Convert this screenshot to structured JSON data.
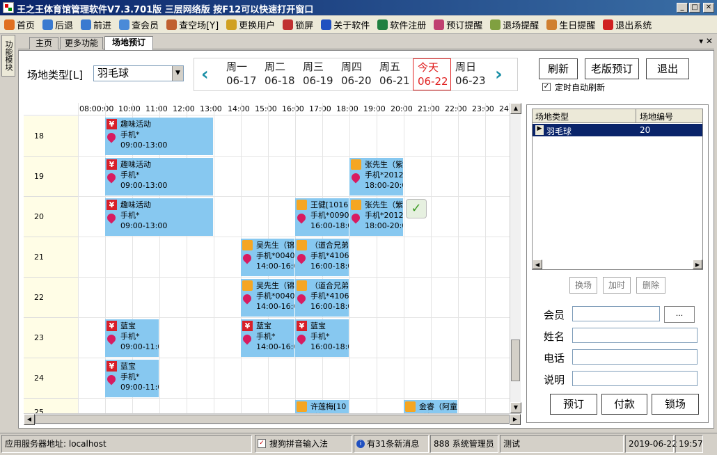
{
  "window": {
    "title": "王之王体育馆管理软件V7.3.701版 三层网络版 按F12可以快速打开窗口",
    "min": "_",
    "max": "□",
    "close": "✕"
  },
  "toolbar": {
    "items": [
      {
        "label": "首页",
        "icon": "home-icon",
        "color": "#e07020"
      },
      {
        "label": "后退",
        "icon": "back-arrow-icon",
        "color": "#3a7ad0"
      },
      {
        "label": "前进",
        "icon": "forward-arrow-icon",
        "color": "#3a7ad0"
      },
      {
        "label": "查会员",
        "icon": "member-icon",
        "color": "#4a8ad8"
      },
      {
        "label": "查空场[Y]",
        "icon": "search-court-icon",
        "color": "#c06030"
      },
      {
        "label": "更换用户",
        "icon": "switch-user-icon",
        "color": "#d0a020"
      },
      {
        "label": "锁屏",
        "icon": "lock-icon",
        "color": "#c03030"
      },
      {
        "label": "关于软件",
        "icon": "info-icon",
        "color": "#2050c0"
      },
      {
        "label": "软件注册",
        "icon": "register-icon",
        "color": "#208040"
      },
      {
        "label": "预订提醒",
        "icon": "booking-reminder-icon",
        "color": "#c04070"
      },
      {
        "label": "退场提醒",
        "icon": "exit-reminder-icon",
        "color": "#80a040"
      },
      {
        "label": "生日提醒",
        "icon": "birthday-icon",
        "color": "#d08030"
      },
      {
        "label": "退出系统",
        "icon": "power-icon",
        "color": "#d02020"
      }
    ]
  },
  "side_tab": "功能模块",
  "tabs": [
    "主页",
    "更多功能",
    "场地预订"
  ],
  "tab_close": "▾ ✕",
  "venue_type_label": "场地类型[L]",
  "venue_type_value": "羽毛球",
  "days": [
    {
      "name": "周一",
      "date": "06-17"
    },
    {
      "name": "周二",
      "date": "06-18"
    },
    {
      "name": "周三",
      "date": "06-19"
    },
    {
      "name": "周四",
      "date": "06-20"
    },
    {
      "name": "周五",
      "date": "06-21"
    },
    {
      "name": "今天",
      "date": "06-22"
    },
    {
      "name": "周日",
      "date": "06-23"
    }
  ],
  "nav_prev": "‹",
  "nav_next": "›",
  "buttons": {
    "refresh": "刷新",
    "old_booking": "老版预订",
    "exit": "退出"
  },
  "auto_refresh_label": "定时自动刷新",
  "auto_refresh_checked": "✓",
  "hours": [
    "08:00:00",
    "10:00",
    "11:00",
    "12:00",
    "13:00",
    "14:00",
    "15:00",
    "16:00",
    "17:00",
    "18:00",
    "19:00",
    "20:00",
    "21:00",
    "22:00",
    "23:00",
    "24"
  ],
  "rows": [
    "18",
    "19",
    "20",
    "21",
    "22",
    "23",
    "24",
    "25"
  ],
  "bookings": [
    {
      "id": "b1",
      "name": "趣味活动",
      "phone": "手机*",
      "time": "09:00-13:00",
      "icon": "yen"
    },
    {
      "id": "b2",
      "name": "趣味活动",
      "phone": "手机*",
      "time": "09:00-13:00",
      "icon": "yen"
    },
    {
      "id": "b3",
      "name": "张先生（紫",
      "phone": "手机*2012",
      "time": "18:00-20:0",
      "icon": "card"
    },
    {
      "id": "b4",
      "name": "趣味活动",
      "phone": "手机*",
      "time": "09:00-13:00",
      "icon": "yen"
    },
    {
      "id": "b5",
      "name": "王健[1016",
      "phone": "手机*0090",
      "time": "16:00-18:0",
      "icon": "card"
    },
    {
      "id": "b6",
      "name": "张先生（紫",
      "phone": "手机*2012",
      "time": "18:00-20:0",
      "icon": "card"
    },
    {
      "id": "b7",
      "name": "吴先生（锦",
      "phone": "手机*0040",
      "time": "14:00-16:0",
      "icon": "card"
    },
    {
      "id": "b8",
      "name": "（道合兄弟",
      "phone": "手机*4106",
      "time": "16:00-18:0",
      "icon": "card"
    },
    {
      "id": "b9",
      "name": "吴先生（锦",
      "phone": "手机*0040",
      "time": "14:00-16:0",
      "icon": "card"
    },
    {
      "id": "b10",
      "name": "（道合兄弟",
      "phone": "手机*4106",
      "time": "16:00-18:0",
      "icon": "card"
    },
    {
      "id": "b11",
      "name": "蓝宝",
      "phone": "手机*",
      "time": "09:00-11:0",
      "icon": "yen"
    },
    {
      "id": "b12",
      "name": "蓝宝",
      "phone": "手机*",
      "time": "14:00-16:0",
      "icon": "yen"
    },
    {
      "id": "b13",
      "name": "蓝宝",
      "phone": "手机*",
      "time": "16:00-18:0",
      "icon": "yen"
    },
    {
      "id": "b14",
      "name": "蓝宝",
      "phone": "手机*",
      "time": "09:00-11:0",
      "icon": "yen"
    },
    {
      "id": "b15",
      "name": "许莲梅[10",
      "phone": "手机*",
      "time": "",
      "icon": "card"
    },
    {
      "id": "b16",
      "name": "金睿（阿童",
      "phone": "手机*",
      "time": "",
      "icon": "card"
    }
  ],
  "court_table": {
    "headers": [
      "场地类型",
      "场地编号"
    ],
    "rows": [
      {
        "type": "羽毛球",
        "number": "20"
      }
    ]
  },
  "court_actions": {
    "swap": "换场",
    "extend": "加时",
    "delete": "删除"
  },
  "form": {
    "member_label": "会员",
    "member_value": "",
    "browse": "...",
    "name_label": "姓名",
    "name_value": "",
    "phone_label": "电话",
    "phone_value": "",
    "note_label": "说明",
    "note_value": ""
  },
  "actions": {
    "book": "预订",
    "pay": "付款",
    "lock": "锁场"
  },
  "status": {
    "server": "应用服务器地址: localhost",
    "ime": "搜狗拼音输入法",
    "messages": "有31条新消息",
    "user": "888 系统管理员",
    "mode": "测试",
    "date": "2019-06-22",
    "time": "19:57"
  },
  "colors": {
    "booking": "#87c8f0",
    "today": "#e02020",
    "selection": "#0a246a",
    "arrow": "#1a8fa6"
  }
}
